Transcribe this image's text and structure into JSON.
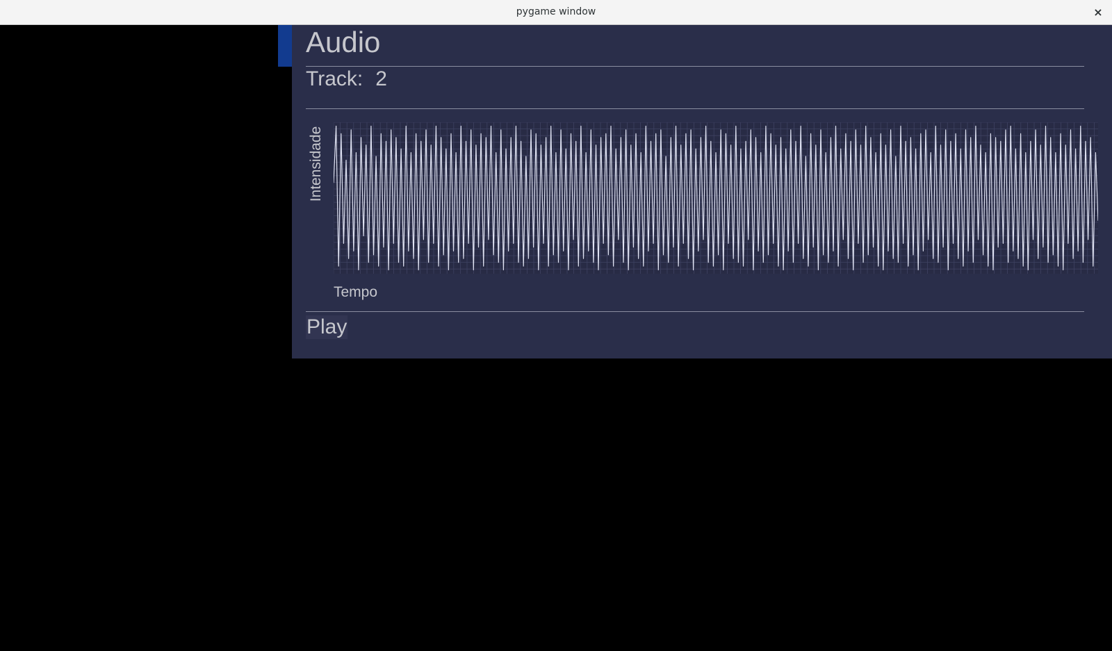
{
  "window": {
    "title": "pygame window",
    "close_icon": "×"
  },
  "panel": {
    "title": "Audio",
    "track_label": "Track:",
    "track_value": "2",
    "play_label": "Play"
  },
  "colors": {
    "accent": "#123b8f",
    "panel_bg": "#2a2e4a",
    "text": "#c6c7cd",
    "waveform": "#dfe2f2",
    "grid": "#3e4262"
  },
  "chart_data": {
    "type": "line",
    "title": "",
    "xlabel": "Tempo",
    "ylabel": "Intensidade",
    "grid": true,
    "legend": "none",
    "series": [
      {
        "values": [
          0.2,
          0.95,
          -0.9,
          0.85,
          -0.6,
          0.5,
          -0.8,
          0.9,
          -0.7,
          0.6,
          -0.95,
          0.8,
          -0.5,
          0.7,
          -0.85,
          0.95,
          -0.75,
          0.55,
          -0.9,
          0.85,
          -0.65,
          0.75,
          -0.95,
          0.9,
          -0.6,
          0.8,
          -0.85,
          0.65,
          -0.9,
          0.95,
          -0.7,
          0.6,
          -0.8,
          0.85,
          -0.95,
          0.75,
          -0.55,
          0.9,
          -0.85,
          0.7,
          -0.6,
          0.95,
          -0.9,
          0.8,
          -0.75,
          0.65,
          -0.95,
          0.85,
          -0.7,
          0.6,
          -0.85,
          0.95,
          -0.8,
          0.75,
          -0.6,
          0.9,
          -0.95,
          0.7,
          -0.65,
          0.85,
          -0.9,
          0.8,
          -0.55,
          0.95,
          -0.75,
          0.6,
          -0.85,
          0.9,
          -0.95,
          0.65,
          -0.7,
          0.8,
          -0.6,
          0.95,
          -0.85,
          0.75,
          -0.9,
          0.55,
          -0.8,
          0.9,
          -0.65,
          0.85,
          -0.95,
          0.7,
          -0.6,
          0.8,
          -0.9,
          0.95,
          -0.75,
          0.6,
          -0.85,
          0.9,
          -0.7,
          0.65,
          -0.95,
          0.85,
          -0.55,
          0.75,
          -0.9,
          0.95,
          -0.8,
          0.6,
          -0.7,
          0.9,
          -0.85,
          0.7,
          -0.95,
          0.8,
          -0.6,
          0.85,
          -0.75,
          0.95,
          -0.9,
          0.65,
          -0.55,
          0.8,
          -0.85,
          0.9,
          -0.95,
          0.7,
          -0.65,
          0.85,
          -0.8,
          0.6,
          -0.9,
          0.95,
          -0.7,
          0.75,
          -0.6,
          0.85,
          -0.95,
          0.9,
          -0.75,
          0.55,
          -0.85,
          0.8,
          -0.65,
          0.95,
          -0.9,
          0.7,
          -0.6,
          0.85,
          -0.8,
          0.9,
          -0.95,
          0.65,
          -0.7,
          0.8,
          -0.55,
          0.95,
          -0.85,
          0.75,
          -0.9,
          0.6,
          -0.75,
          0.9,
          -0.95,
          0.85,
          -0.6,
          0.7,
          -0.8,
          0.95,
          -0.85,
          0.65,
          -0.9,
          0.75,
          -0.55,
          0.9,
          -0.95,
          0.8,
          -0.7,
          0.6,
          -0.85,
          0.95,
          -0.75,
          0.85,
          -0.6,
          0.7,
          -0.9,
          0.8,
          -0.95,
          0.65,
          -0.7,
          0.9,
          -0.85,
          0.75,
          -0.6,
          0.95,
          -0.8,
          0.55,
          -0.9,
          0.85,
          -0.65,
          0.7,
          -0.95,
          0.9,
          -0.75,
          0.6,
          -0.85,
          0.8,
          -0.7,
          0.95,
          -0.9,
          0.65,
          -0.55,
          0.85,
          -0.8,
          0.75,
          -0.95,
          0.9,
          -0.6,
          0.7,
          -0.85,
          0.95,
          -0.75,
          0.8,
          -0.65,
          0.6,
          -0.9,
          0.85,
          -0.95,
          0.7,
          -0.7,
          0.9,
          -0.8,
          0.55,
          -0.85,
          0.95,
          -0.6,
          0.75,
          -0.9,
          0.8,
          -0.75,
          0.65,
          -0.95,
          0.85,
          -0.7,
          0.9,
          -0.55,
          0.6,
          -0.8,
          0.95,
          -0.85,
          0.7,
          -0.65,
          0.9,
          -0.95,
          0.75,
          -0.6,
          0.85,
          -0.8,
          0.65,
          -0.9,
          0.9,
          -0.7,
          0.8,
          -0.85,
          0.95,
          -0.55,
          0.7,
          -0.75,
          0.6,
          -0.9,
          0.85,
          -0.95,
          0.8,
          -0.65,
          0.75,
          -0.6,
          0.9,
          -0.85,
          0.95,
          -0.7,
          0.65,
          -0.8,
          0.85,
          -0.9,
          0.6,
          -0.95,
          0.75,
          -0.55,
          0.9,
          -0.8,
          0.7,
          -0.65,
          0.95,
          -0.85,
          0.8,
          -0.75,
          0.6,
          -0.9,
          0.85,
          -0.95,
          0.7,
          -0.6,
          0.9,
          -0.8,
          0.65,
          -0.7,
          0.95,
          -0.85,
          0.75,
          -0.55,
          0.8,
          -0.9,
          0.6,
          -0.3
        ]
      }
    ],
    "ylim": [
      -1,
      1
    ]
  }
}
